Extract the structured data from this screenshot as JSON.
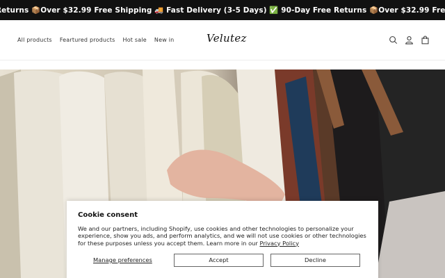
{
  "announcement": {
    "text": "Returns 📦Over $32.99 Free Shipping        🚚 Fast Delivery (3-5 Days) ✅ 90-Day Free Returns 📦Over $32.99 Free Shipping"
  },
  "header": {
    "nav": [
      "All products",
      "Feartured products",
      "Hot sale",
      "New in"
    ],
    "logo": "Velutez",
    "icons": [
      "search-icon",
      "account-icon",
      "cart-icon"
    ]
  },
  "hero": {
    "image": "clothing-rack-photo"
  },
  "cookie": {
    "title": "Cookie consent",
    "body": "We and our partners, including Shopify, use cookies and other technologies to personalize your experience, show you ads, and perform analytics, and we will not use cookies or other technologies for these purposes unless you accept them. Learn more in our ",
    "policy_link": "Privacy Policy",
    "manage_label": "Manage preferences",
    "accept_label": "Accept",
    "decline_label": "Decline"
  },
  "colors": {
    "announcement_bg": "#111111",
    "text": "#222222"
  }
}
